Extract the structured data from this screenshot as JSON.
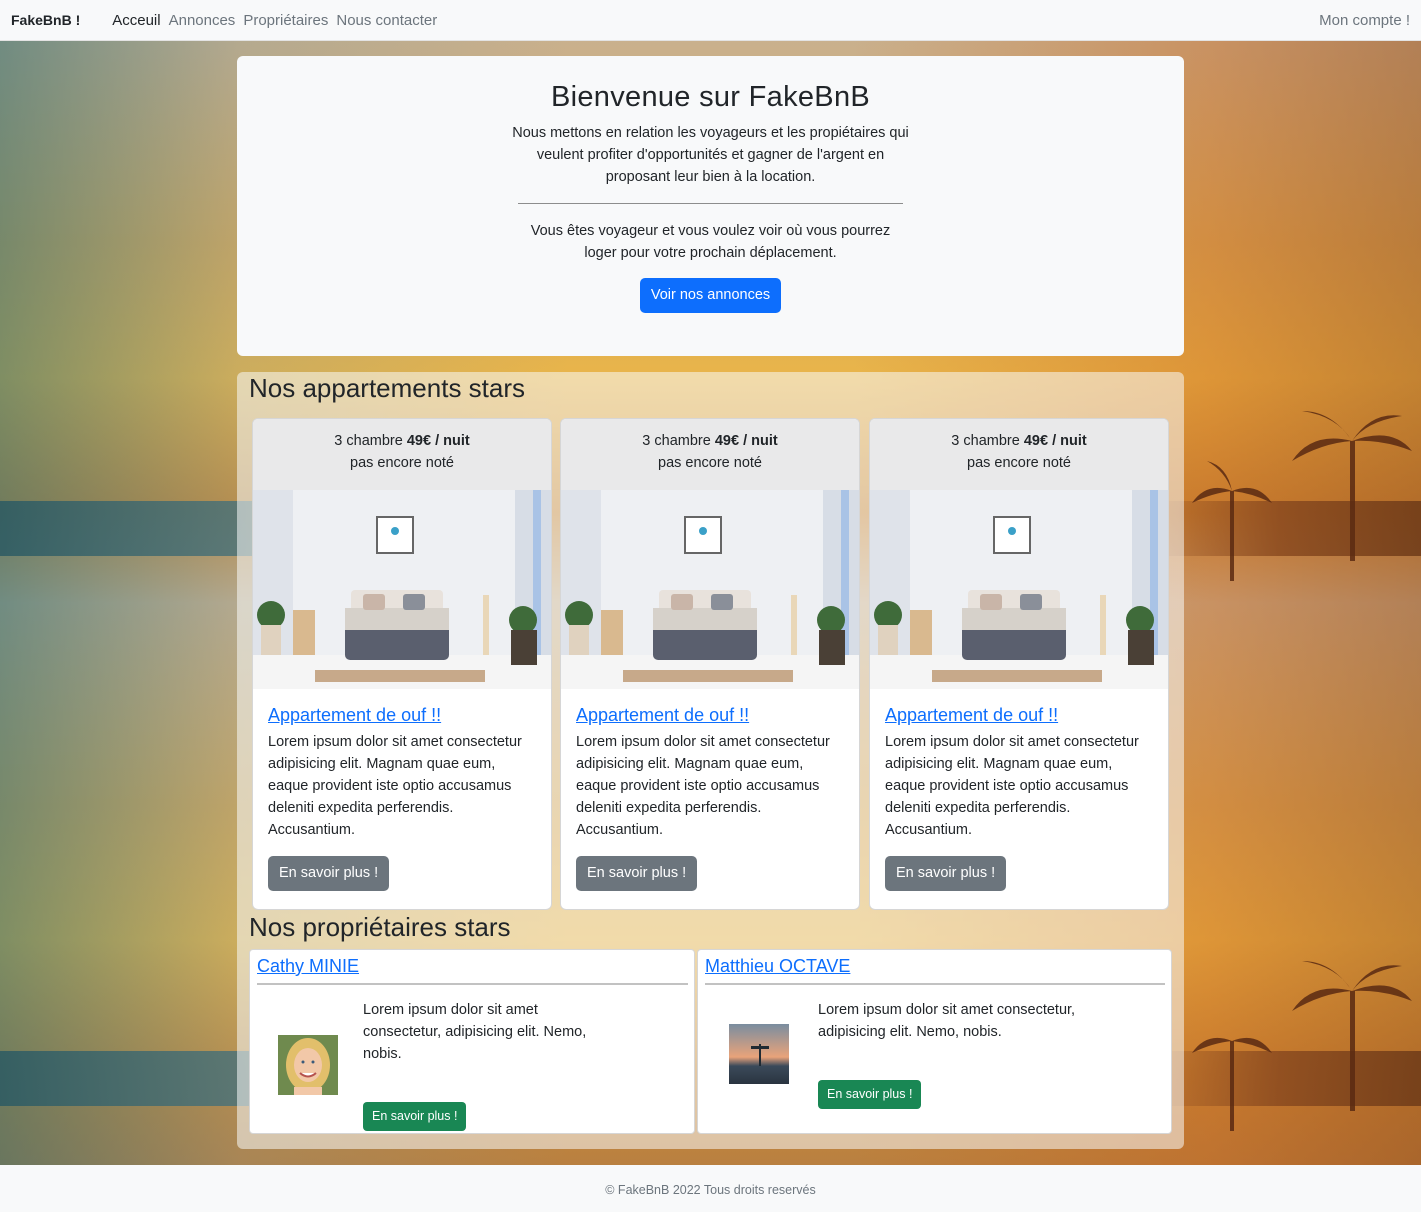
{
  "navbar": {
    "brand": "FakeBnB !",
    "links": [
      {
        "label": "Acceuil"
      },
      {
        "label": "Annonces"
      },
      {
        "label": "Propriétaires"
      },
      {
        "label": "Nous contacter"
      }
    ],
    "account": "Mon compte !"
  },
  "hero": {
    "title": "Bienvenue sur FakeBnB",
    "lead": "Nous mettons en relation les voyageurs et les propiétaires qui veulent profiter d'opportunités et gagner de l'argent en proposant leur bien à la location.",
    "sub": "Vous êtes voyageur et vous voulez voir où vous pourrez loger pour votre prochain déplacement.",
    "button": "Voir nos annonces"
  },
  "apartments": {
    "title": "Nos appartements stars",
    "cards": [
      {
        "rooms": "3 chambre",
        "price": "49€ / nuit",
        "rating": "pas encore noté",
        "name": "Appartement de ouf !!",
        "text": "Lorem ipsum dolor sit amet consectetur adipisicing elit. Magnam quae eum, eaque provident iste optio accusamus deleniti expedita perferendis. Accusantium.",
        "button": "En savoir plus !"
      },
      {
        "rooms": "3 chambre",
        "price": "49€ / nuit",
        "rating": "pas encore noté",
        "name": "Appartement de ouf !!",
        "text": "Lorem ipsum dolor sit amet consectetur adipisicing elit. Magnam quae eum, eaque provident iste optio accusamus deleniti expedita perferendis. Accusantium.",
        "button": "En savoir plus !"
      },
      {
        "rooms": "3 chambre",
        "price": "49€ / nuit",
        "rating": "pas encore noté",
        "name": "Appartement de ouf !!",
        "text": "Lorem ipsum dolor sit amet consectetur adipisicing elit. Magnam quae eum, eaque provident iste optio accusamus deleniti expedita perferendis. Accusantium.",
        "button": "En savoir plus !"
      }
    ]
  },
  "owners": {
    "title": "Nos propriétaires stars",
    "list": [
      {
        "name": "Cathy MINIE",
        "text": "Lorem ipsum dolor sit amet consectetur, adipisicing elit. Nemo, nobis.",
        "button": "En savoir plus !"
      },
      {
        "name": "Matthieu OCTAVE",
        "text": "Lorem ipsum dolor sit amet consectetur, adipisicing elit. Nemo, nobis.",
        "button": "En savoir plus !"
      }
    ]
  },
  "footer": {
    "text": "© FakeBnB 2022 Tous droits reservés"
  },
  "colors": {
    "primary": "#0d6efd",
    "secondary": "#6c757d",
    "success": "#198754",
    "light": "#f8f9fa"
  }
}
